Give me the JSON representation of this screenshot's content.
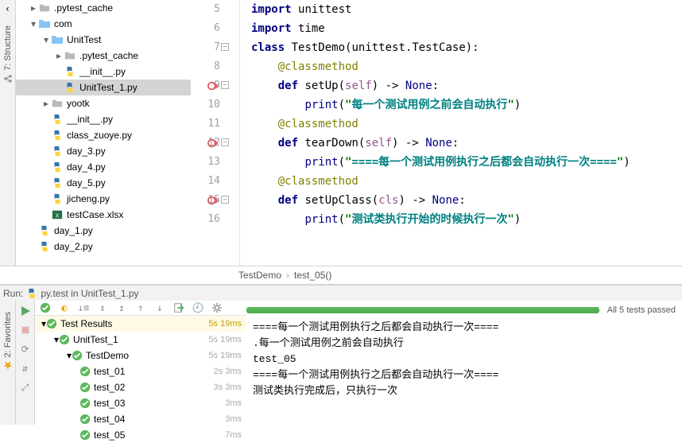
{
  "sidebar_tabs": {
    "structure": "7: Structure"
  },
  "project_tree": {
    "items": [
      {
        "depth": 1,
        "arrow": "▸",
        "icon": "folder",
        "label": ".pytest_cache"
      },
      {
        "depth": 1,
        "arrow": "▾",
        "icon": "folder-open",
        "label": "com"
      },
      {
        "depth": 2,
        "arrow": "▾",
        "icon": "folder-open",
        "label": "UnitTest"
      },
      {
        "depth": 3,
        "arrow": "▸",
        "icon": "folder",
        "label": ".pytest_cache"
      },
      {
        "depth": 3,
        "arrow": " ",
        "icon": "py",
        "label": "__init__.py"
      },
      {
        "depth": 3,
        "arrow": " ",
        "icon": "py",
        "label": "UnitTest_1.py",
        "selected": true
      },
      {
        "depth": 2,
        "arrow": "▸",
        "icon": "folder",
        "label": "yootk"
      },
      {
        "depth": 2,
        "arrow": " ",
        "icon": "py",
        "label": "__init__.py"
      },
      {
        "depth": 2,
        "arrow": " ",
        "icon": "py",
        "label": "class_zuoye.py"
      },
      {
        "depth": 2,
        "arrow": " ",
        "icon": "py",
        "label": "day_3.py"
      },
      {
        "depth": 2,
        "arrow": " ",
        "icon": "py",
        "label": "day_4.py"
      },
      {
        "depth": 2,
        "arrow": " ",
        "icon": "py",
        "label": "day_5.py"
      },
      {
        "depth": 2,
        "arrow": " ",
        "icon": "py",
        "label": "jicheng.py"
      },
      {
        "depth": 2,
        "arrow": " ",
        "icon": "xlsx",
        "label": "testCase.xlsx"
      },
      {
        "depth": 1,
        "arrow": " ",
        "icon": "py",
        "label": "day_1.py"
      },
      {
        "depth": 1,
        "arrow": " ",
        "icon": "py",
        "label": "day_2.py"
      }
    ]
  },
  "editor": {
    "lines": [
      {
        "n": 5,
        "html": "<span class='kw'>import</span> <span class='ident'>unittest</span>"
      },
      {
        "n": 6,
        "html": "<span class='kw'>import</span> <span class='ident'>time</span>"
      },
      {
        "n": 7,
        "fold": "-",
        "html": "<span class='kw'>class</span> <span class='cls'>TestDemo</span>(unittest.TestCase):"
      },
      {
        "n": 8,
        "html": "    <span class='deco'>@classmethod</span>"
      },
      {
        "n": 9,
        "run": "red",
        "fold": "-",
        "html": "    <span class='kw'>def</span> <span class='fname'>setUp</span>(<span class='self'>self</span>) -&gt; <span class='builtin'>None</span>:"
      },
      {
        "n": 10,
        "html": "        <span class='builtin'>print</span>(<span class='strq'>\"</span><span class='str'>每一个测试用例之前会自动执行</span><span class='strq'>\"</span>)"
      },
      {
        "n": 11,
        "html": "    <span class='deco'>@classmethod</span>"
      },
      {
        "n": 12,
        "run": "red",
        "fold": "-",
        "html": "    <span class='kw'>def</span> <span class='fname'>tearDown</span>(<span class='self'>self</span>) -&gt; <span class='builtin'>None</span>:"
      },
      {
        "n": 13,
        "html": "        <span class='builtin'>print</span>(<span class='strq'>\"</span><span class='str'>====每一个测试用例执行之后都会自动执行一次====</span><span class='strq'>\"</span>)"
      },
      {
        "n": 14,
        "html": "    <span class='deco'>@classmethod</span>"
      },
      {
        "n": 15,
        "run": "red",
        "fold": "-",
        "html": "    <span class='kw'>def</span> <span class='fname'>setUpClass</span>(<span class='self'>cls</span>) -&gt; <span class='builtin'>None</span>:"
      },
      {
        "n": 16,
        "html": "        <span class='builtin'>print</span>(<span class='strq'>\"</span><span class='str'>测试类执行开始的时候执行一次</span><span class='strq'>\"</span>)"
      }
    ]
  },
  "breadcrumb": {
    "items": [
      "TestDemo",
      "test_05()"
    ]
  },
  "run_tab": {
    "label": "Run:",
    "config": "py.test in UnitTest_1.py"
  },
  "tests": {
    "summary": "All 5 tests passed",
    "header": {
      "label": "Test Results",
      "time": "5s 19ms"
    },
    "nodes": [
      {
        "depth": 1,
        "arrow": "▾",
        "label": "UnitTest_1",
        "time": "5s 19ms"
      },
      {
        "depth": 2,
        "arrow": "▾",
        "label": "TestDemo",
        "time": "5s 19ms"
      },
      {
        "depth": 3,
        "arrow": " ",
        "label": "test_01",
        "time": "2s 3ms"
      },
      {
        "depth": 3,
        "arrow": " ",
        "label": "test_02",
        "time": "3s 3ms"
      },
      {
        "depth": 3,
        "arrow": " ",
        "label": "test_03",
        "time": "3ms"
      },
      {
        "depth": 3,
        "arrow": " ",
        "label": "test_04",
        "time": "3ms"
      },
      {
        "depth": 3,
        "arrow": " ",
        "label": "test_05",
        "time": "7ms"
      }
    ]
  },
  "console": {
    "lines": [
      "====每一个测试用例执行之后都会自动执行一次====",
      ".每一个测试用例之前会自动执行",
      "test_05",
      "====每一个测试用例执行之后都会自动执行一次====",
      "测试类执行完成后，只执行一次"
    ]
  },
  "favorites_tab": "2: Favorites"
}
